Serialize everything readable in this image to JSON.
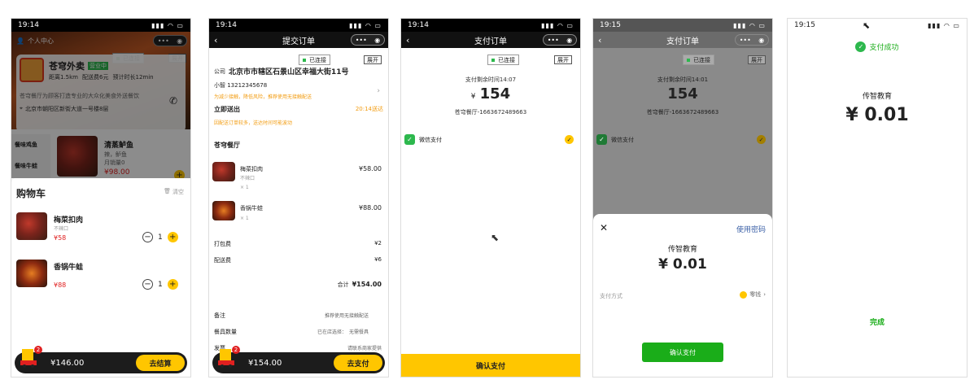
{
  "status_time": "19:14",
  "status_time_p4": "19:15",
  "status_time_p5": "19:15",
  "connected_label": "已连接",
  "expand_label": "展开",
  "capsule": "•••",
  "phone1": {
    "personal_center": "个人中心",
    "shop_name": "苍穹外卖",
    "open_badge": "营业中",
    "distance": "距离1.5km",
    "delivery_fee": "配送费6元",
    "delivery_time": "预计时长12min",
    "intro": "苍穹餐厅为顾客打造专业的大众化美食外送餐饮",
    "address": "北京市朝阳区新街大道一号楼8层",
    "categories": [
      "餐味鸡鱼",
      "餐味牛蛙"
    ],
    "dish_name": "清蒸鲈鱼",
    "dish_desc": "辣，鲈鱼",
    "dish_sales": "月销量0",
    "dish_price": "¥98.00",
    "cart_title": "购物车",
    "clear_label": "清空",
    "cart_items": [
      {
        "name": "梅菜扣肉",
        "spec": "不辣口",
        "price": "¥58",
        "qty": "1"
      },
      {
        "name": "香锅牛蛙",
        "spec": "",
        "price": "¥88",
        "qty": "1"
      }
    ],
    "badge": "2",
    "total": "¥146.00",
    "checkout": "去结算"
  },
  "phone2": {
    "title": "提交订单",
    "company_tag": "公司",
    "address": "北京市市辖区石景山区幸福大街11号",
    "contact": "小智 13212345678",
    "privacy_note": "为减少接触，降低风险，推荐使用无接触配送",
    "deliver_now": "立即送出",
    "deliver_time": "20:14送达",
    "deliver_note": "因配送订单较多，送达时间可能波动",
    "shop": "苍穹餐厅",
    "items": [
      {
        "name": "梅菜扣肉",
        "spec": "不辣口",
        "qty": "× 1",
        "price": "¥58.00"
      },
      {
        "name": "香锅牛蛙",
        "spec": "",
        "qty": "× 1",
        "price": "¥88.00"
      }
    ],
    "packing_label": "打包费",
    "packing_value": "¥2",
    "delivery_label": "配送费",
    "delivery_value": "¥6",
    "total_label": "合计",
    "total_value": "¥154.00",
    "remark_label": "备注",
    "remark_value": "推荐使用无接触配送",
    "tableware_label": "餐具数量",
    "tableware_value": "无需餐具",
    "tableware_prefix": "已在店选择：",
    "invoice_label": "发票",
    "invoice_value": "请联系商家提供",
    "badge": "2",
    "bar_total": "¥154.00",
    "pay_btn": "去支付"
  },
  "phone3": {
    "title": "支付订单",
    "remaining_time": "支付剩余时间14:07",
    "amount": "154",
    "currency": "¥",
    "order_no": "苍穹餐厅-1663672489663",
    "method": "微信支付",
    "confirm": "确认支付"
  },
  "phone4": {
    "title": "支付订单",
    "remaining_time": "支付剩余时间14:01",
    "amount": "154",
    "order_no": "苍穹餐厅-1663672489663",
    "method": "微信支付",
    "use_password": "使用密码",
    "payee": "传智教育",
    "pay_amount": "¥ 0.01",
    "pay_method_label": "支付方式",
    "pay_method_value": "零钱",
    "confirm_pay": "确认支付"
  },
  "phone5": {
    "success_title": "支付成功",
    "payee": "传智教育",
    "amount": "¥ 0.01",
    "done": "完成"
  }
}
